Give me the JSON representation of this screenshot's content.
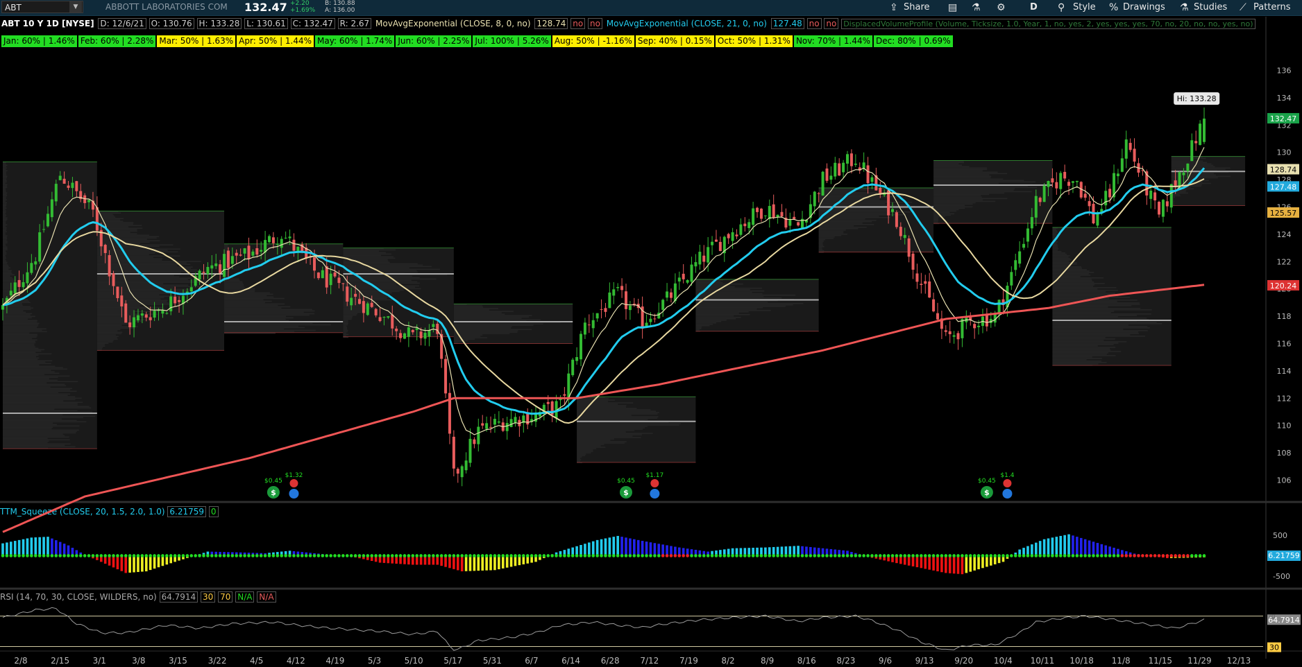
{
  "header": {
    "symbol": "ABT",
    "company": "ABBOTT LABORATORIES COM",
    "last": "132.47",
    "change": "+2.20",
    "change_pct": "+1.69%",
    "bid": "B: 130.88",
    "ask": "A: 136.00",
    "buttons": {
      "share": "Share",
      "interval": "D",
      "style": "Style",
      "drawings": "Drawings",
      "studies": "Studies",
      "patterns": "Patterns"
    }
  },
  "chart_header": {
    "title": "ABT 10 Y 1D [NYSE]",
    "date": "D: 12/6/21",
    "open": "O: 130.76",
    "high": "H: 133.28",
    "low": "L: 130.61",
    "close": "C: 132.47",
    "range": "R: 2.67",
    "ma8": "MovAvgExponential (CLOSE, 8, 0, no)",
    "ma8_val": "128.74",
    "no1": "no",
    "no2": "no",
    "ma21": "MovAvgExponential (CLOSE, 21, 0, no)",
    "ma21_val": "127.48",
    "no3": "no",
    "no4": "no",
    "dvp": "DisplacedVolumeProfile (Volume, Ticksize, 1.0, Year, 1, no, yes, 2, yes, yes, yes, 70, no, 20, no, no, yes, no)"
  },
  "seasonal": [
    {
      "label": "Jan: 60% | 1.46%",
      "color": "green"
    },
    {
      "label": "Feb: 60% | 2.28%",
      "color": "green"
    },
    {
      "label": "Mar: 50% | 1.63%",
      "color": "yellow"
    },
    {
      "label": "Apr: 50% | 1.44%",
      "color": "yellow"
    },
    {
      "label": "May: 60% | 1.74%",
      "color": "green"
    },
    {
      "label": "Jun: 60% | 2.25%",
      "color": "green"
    },
    {
      "label": "Jul: 100% | 5.26%",
      "color": "green"
    },
    {
      "label": "Aug: 50% | -1.16%",
      "color": "yellow"
    },
    {
      "label": "Sep: 40% | 0.15%",
      "color": "yellow"
    },
    {
      "label": "Oct: 50% | 1.31%",
      "color": "yellow"
    },
    {
      "label": "Nov: 70% | 1.44%",
      "color": "green"
    },
    {
      "label": "Dec: 80% | 0.69%",
      "color": "green"
    }
  ],
  "squeeze": {
    "label": "TTM_Squeeze (CLOSE, 20, 1.5, 2.0, 1.0)",
    "value": "6.21759",
    "zero": "0"
  },
  "rsi": {
    "label": "RSI (14, 70, 30, CLOSE, WILDERS, no)",
    "value": "64.7914",
    "ob": "30",
    "os": "70",
    "na1": "N/A",
    "na2": "N/A"
  },
  "colors": {
    "up": "#33bb33",
    "down": "#e85c5c",
    "ema8": "#e8e0b0",
    "ema21": "#22ccee",
    "ema200": "#ee5555",
    "sqz_cyan": "#22ccee",
    "sqz_blue": "#2222ee",
    "sqz_red": "#ee1111",
    "sqz_yellow": "#eeee22"
  },
  "chart_data": {
    "type": "candlestick",
    "ylim": [
      104.5,
      137.5
    ],
    "price_ticks": [
      "106",
      "108",
      "110",
      "112",
      "114",
      "116",
      "118",
      "120",
      "122",
      "124",
      "126",
      "128",
      "130",
      "132",
      "134",
      "136"
    ],
    "x_labels": [
      "2/8",
      "2/15",
      "3/1",
      "3/8",
      "3/15",
      "3/22",
      "4/5",
      "4/12",
      "4/19",
      "5/3",
      "5/10",
      "5/17",
      "5/31",
      "6/7",
      "6/14",
      "6/28",
      "7/12",
      "7/19",
      "8/2",
      "8/9",
      "8/16",
      "8/23",
      "9/6",
      "9/13",
      "9/20",
      "10/4",
      "10/11",
      "10/18",
      "11/8",
      "11/15",
      "11/29",
      "12/13"
    ],
    "hi_label": "Hi: 133.28",
    "price_tags": [
      {
        "label": "132.47",
        "value": 132.47,
        "color": "green"
      },
      {
        "label": "128.74",
        "value": 128.74,
        "color": "cream"
      },
      {
        "label": "127.48",
        "value": 127.48,
        "color": "cyan"
      },
      {
        "label": "125.57",
        "value": 125.57,
        "color": "amber"
      },
      {
        "label": "120.24",
        "value": 120.24,
        "color": "red"
      }
    ],
    "close_anchors": [
      [
        0,
        118.6
      ],
      [
        8,
        122.5
      ],
      [
        14,
        128.4
      ],
      [
        22,
        125.6
      ],
      [
        30,
        117.4
      ],
      [
        40,
        118.8
      ],
      [
        50,
        121.5
      ],
      [
        60,
        122.5
      ],
      [
        68,
        124.1
      ],
      [
        76,
        121.3
      ],
      [
        84,
        119.6
      ],
      [
        92,
        118.2
      ],
      [
        100,
        116.4
      ],
      [
        106,
        117.2
      ],
      [
        110,
        106.2
      ],
      [
        116,
        109.6
      ],
      [
        122,
        110.3
      ],
      [
        130,
        110.8
      ],
      [
        136,
        111.5
      ],
      [
        142,
        117.4
      ],
      [
        150,
        119.6
      ],
      [
        156,
        117.6
      ],
      [
        162,
        119.2
      ],
      [
        170,
        122.1
      ],
      [
        178,
        124.3
      ],
      [
        186,
        126.0
      ],
      [
        194,
        124.6
      ],
      [
        200,
        128.0
      ],
      [
        208,
        129.6
      ],
      [
        212,
        127.7
      ],
      [
        218,
        125.2
      ],
      [
        224,
        120.4
      ],
      [
        230,
        116.3
      ],
      [
        236,
        117.6
      ],
      [
        242,
        118.0
      ],
      [
        246,
        121.0
      ],
      [
        252,
        126.4
      ],
      [
        258,
        128.2
      ],
      [
        262,
        128.0
      ],
      [
        266,
        125.1
      ],
      [
        270,
        127.0
      ],
      [
        274,
        130.8
      ],
      [
        278,
        128.0
      ],
      [
        282,
        125.2
      ],
      [
        286,
        127.9
      ],
      [
        290,
        130.3
      ],
      [
        293,
        132.47
      ]
    ],
    "ema200_anchors": [
      [
        0,
        102.2
      ],
      [
        20,
        104.8
      ],
      [
        60,
        107.6
      ],
      [
        100,
        111.0
      ],
      [
        110,
        112.0
      ],
      [
        140,
        112.0
      ],
      [
        160,
        113.0
      ],
      [
        200,
        115.5
      ],
      [
        230,
        117.8
      ],
      [
        255,
        118.6
      ],
      [
        270,
        119.5
      ],
      [
        293,
        120.3
      ]
    ],
    "dividends": [
      {
        "label": "$0.45",
        "bar": 66
      },
      {
        "label": "$1.32",
        "bar": 71
      },
      {
        "label": "$0.45",
        "bar": 152
      },
      {
        "label": "$1.17",
        "bar": 159
      },
      {
        "label": "$0.45",
        "bar": 240
      },
      {
        "label": "$1.4",
        "bar": 245
      }
    ],
    "volume_profiles": [
      {
        "x0": 0,
        "x1": 23,
        "top": 129.3,
        "bottom": 108.3,
        "poc": 110.9
      },
      {
        "x0": 23,
        "x1": 54,
        "top": 125.7,
        "bottom": 115.5,
        "poc": 121.1
      },
      {
        "x0": 54,
        "x1": 83,
        "top": 123.3,
        "bottom": 116.8,
        "poc": 117.6
      },
      {
        "x0": 83,
        "x1": 110,
        "top": 123.0,
        "bottom": 116.5,
        "poc": 121.1
      },
      {
        "x0": 110,
        "x1": 139,
        "top": 118.9,
        "bottom": 116.0,
        "poc": 117.6
      },
      {
        "x0": 140,
        "x1": 169,
        "top": 112.1,
        "bottom": 107.3,
        "poc": 110.3
      },
      {
        "x0": 169,
        "x1": 199,
        "top": 120.7,
        "bottom": 116.9,
        "poc": 119.2
      },
      {
        "x0": 199,
        "x1": 227,
        "top": 127.4,
        "bottom": 122.7,
        "poc": 126.0
      },
      {
        "x0": 227,
        "x1": 256,
        "top": 129.4,
        "bottom": 124.8,
        "poc": 127.6
      },
      {
        "x0": 256,
        "x1": 285,
        "top": 124.5,
        "bottom": 114.4,
        "poc": 117.7
      },
      {
        "x0": 285,
        "x1": 303,
        "top": 129.7,
        "bottom": 126.1,
        "poc": 128.6
      }
    ],
    "squeeze_ylim": [
      -750,
      900
    ],
    "squeeze_ticks": [
      "500",
      "-500"
    ],
    "squeeze_anchors": [
      [
        0,
        300
      ],
      [
        7,
        440
      ],
      [
        11,
        460
      ],
      [
        16,
        250
      ],
      [
        20,
        20
      ],
      [
        24,
        -150
      ],
      [
        30,
        -420
      ],
      [
        35,
        -380
      ],
      [
        42,
        -150
      ],
      [
        50,
        100
      ],
      [
        58,
        80
      ],
      [
        64,
        60
      ],
      [
        70,
        120
      ],
      [
        78,
        40
      ],
      [
        85,
        -20
      ],
      [
        92,
        -170
      ],
      [
        100,
        -220
      ],
      [
        106,
        -220
      ],
      [
        112,
        -380
      ],
      [
        120,
        -350
      ],
      [
        130,
        -150
      ],
      [
        135,
        80
      ],
      [
        145,
        380
      ],
      [
        150,
        480
      ],
      [
        156,
        360
      ],
      [
        165,
        200
      ],
      [
        172,
        100
      ],
      [
        178,
        180
      ],
      [
        186,
        200
      ],
      [
        194,
        240
      ],
      [
        200,
        180
      ],
      [
        206,
        120
      ],
      [
        212,
        -50
      ],
      [
        218,
        -180
      ],
      [
        224,
        -300
      ],
      [
        230,
        -420
      ],
      [
        234,
        -450
      ],
      [
        244,
        -150
      ],
      [
        248,
        150
      ],
      [
        254,
        400
      ],
      [
        260,
        520
      ],
      [
        268,
        280
      ],
      [
        276,
        50
      ],
      [
        284,
        -60
      ],
      [
        293,
        -40
      ]
    ],
    "rsi_ylim": [
      25,
      85
    ],
    "rsi_ticks": [
      "30",
      "70",
      "64.7914"
    ],
    "rsi_anchors": [
      [
        0,
        68
      ],
      [
        8,
        78
      ],
      [
        13,
        80
      ],
      [
        18,
        60
      ],
      [
        24,
        48
      ],
      [
        30,
        48
      ],
      [
        40,
        58
      ],
      [
        48,
        54
      ],
      [
        56,
        60
      ],
      [
        66,
        62
      ],
      [
        72,
        58
      ],
      [
        80,
        54
      ],
      [
        86,
        52
      ],
      [
        92,
        50
      ],
      [
        100,
        46
      ],
      [
        106,
        50
      ],
      [
        110,
        24
      ],
      [
        116,
        38
      ],
      [
        124,
        42
      ],
      [
        130,
        48
      ],
      [
        136,
        58
      ],
      [
        144,
        62
      ],
      [
        150,
        58
      ],
      [
        156,
        55
      ],
      [
        162,
        60
      ],
      [
        170,
        65
      ],
      [
        178,
        68
      ],
      [
        186,
        70
      ],
      [
        194,
        63
      ],
      [
        200,
        68
      ],
      [
        208,
        70
      ],
      [
        212,
        64
      ],
      [
        218,
        52
      ],
      [
        224,
        36
      ],
      [
        230,
        25
      ],
      [
        236,
        32
      ],
      [
        242,
        32
      ],
      [
        248,
        48
      ],
      [
        252,
        62
      ],
      [
        258,
        67
      ],
      [
        264,
        70
      ],
      [
        270,
        66
      ],
      [
        278,
        60
      ],
      [
        286,
        54
      ],
      [
        293,
        64.8
      ]
    ]
  }
}
